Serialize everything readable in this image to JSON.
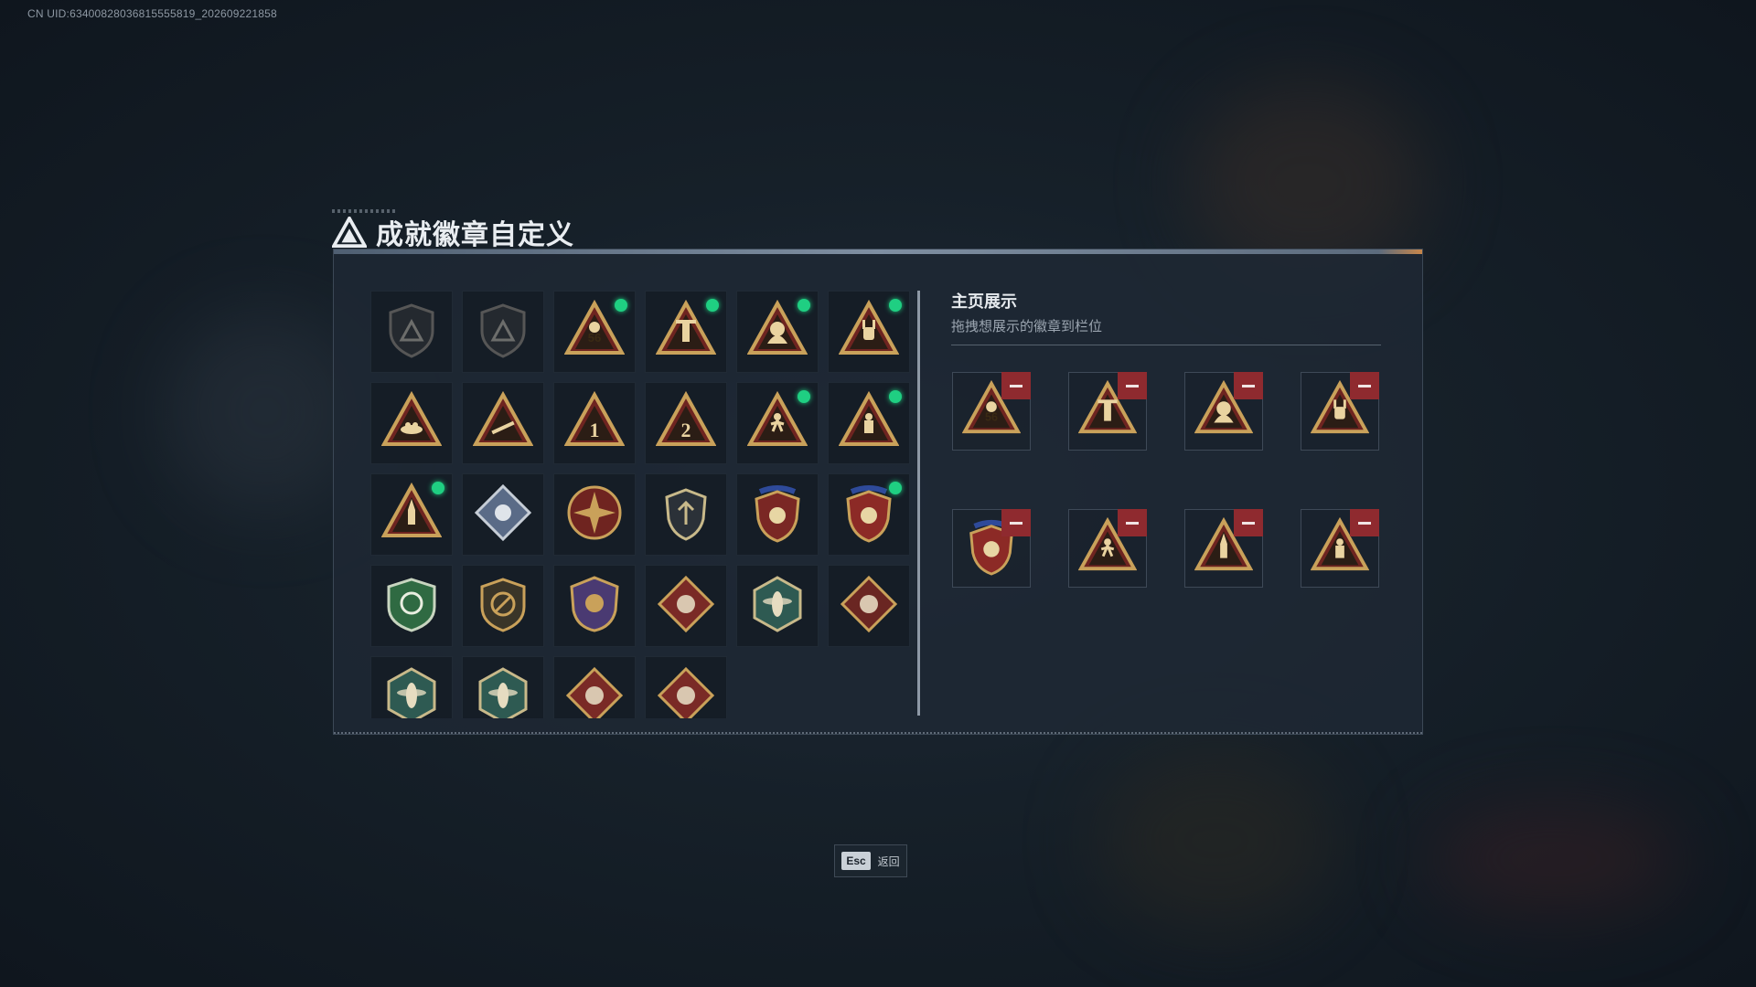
{
  "uid_text": "CN UID:6340082803681555581​9_202609221858",
  "title": "成就徽章自定义",
  "badges": [
    {
      "name": "shield-triangle-badge",
      "locked": true,
      "new": false
    },
    {
      "name": "helicopter-shield-badge",
      "locked": true,
      "new": false
    },
    {
      "name": "number-56-badge",
      "locked": false,
      "new": true
    },
    {
      "name": "tower-triangle-badge",
      "locked": false,
      "new": true
    },
    {
      "name": "hooded-figure-badge",
      "locked": false,
      "new": true
    },
    {
      "name": "rock-hand-badge",
      "locked": false,
      "new": true
    },
    {
      "name": "nest-triangle-badge",
      "locked": false,
      "new": false
    },
    {
      "name": "rifle-triangle-badge",
      "locked": false,
      "new": false
    },
    {
      "name": "number-1-badge",
      "locked": false,
      "new": false
    },
    {
      "name": "number-2-badge",
      "locked": false,
      "new": false
    },
    {
      "name": "runner-triangle-badge",
      "locked": false,
      "new": true
    },
    {
      "name": "soldier-triangle-badge",
      "locked": false,
      "new": true
    },
    {
      "name": "rocket-triangle-badge",
      "locked": false,
      "new": true
    },
    {
      "name": "silver-diamond-badge",
      "locked": false,
      "new": false
    },
    {
      "name": "compass-star-badge",
      "locked": false,
      "new": false
    },
    {
      "name": "emblem-shield-badge",
      "locked": false,
      "new": false
    },
    {
      "name": "star-wreath-shield-badge",
      "locked": false,
      "new": false
    },
    {
      "name": "star-wreath-red-badge",
      "locked": false,
      "new": true
    },
    {
      "name": "green-crosshair-shield-badge",
      "locked": false,
      "new": false
    },
    {
      "name": "no-gun-shield-badge",
      "locked": false,
      "new": false
    },
    {
      "name": "purple-gold-crest-badge",
      "locked": false,
      "new": false
    },
    {
      "name": "wolf-diamond-badge",
      "locked": false,
      "new": false
    },
    {
      "name": "hornet-hexagon-badge",
      "locked": false,
      "new": false
    },
    {
      "name": "dragon-diamond-badge",
      "locked": false,
      "new": false
    },
    {
      "name": "wasp-hexagon-badge",
      "locked": false,
      "new": false
    },
    {
      "name": "dragonfly-hexagon-badge",
      "locked": false,
      "new": false
    },
    {
      "name": "horse-diamond-badge",
      "locked": false,
      "new": false
    },
    {
      "name": "wrench-diamond-badge",
      "locked": false,
      "new": false
    }
  ],
  "showcase": {
    "title": "主页展示",
    "subtitle": "拖拽想展示的徽章到栏位",
    "slots": [
      {
        "badge": "number-56-badge"
      },
      {
        "badge": "tower-triangle-badge"
      },
      {
        "badge": "hooded-figure-badge"
      },
      {
        "badge": "rock-hand-badge"
      },
      {
        "badge": "star-wreath-red-badge"
      },
      {
        "badge": "runner-triangle-badge"
      },
      {
        "badge": "rocket-triangle-badge"
      },
      {
        "badge": "soldier-triangle-badge"
      }
    ]
  },
  "footer": {
    "esc_key": "Esc",
    "esc_label": "返回"
  },
  "colors": {
    "accent_green": "#1fcf82",
    "remove_red": "#8f2a2f",
    "gold": "#c9a15a"
  }
}
